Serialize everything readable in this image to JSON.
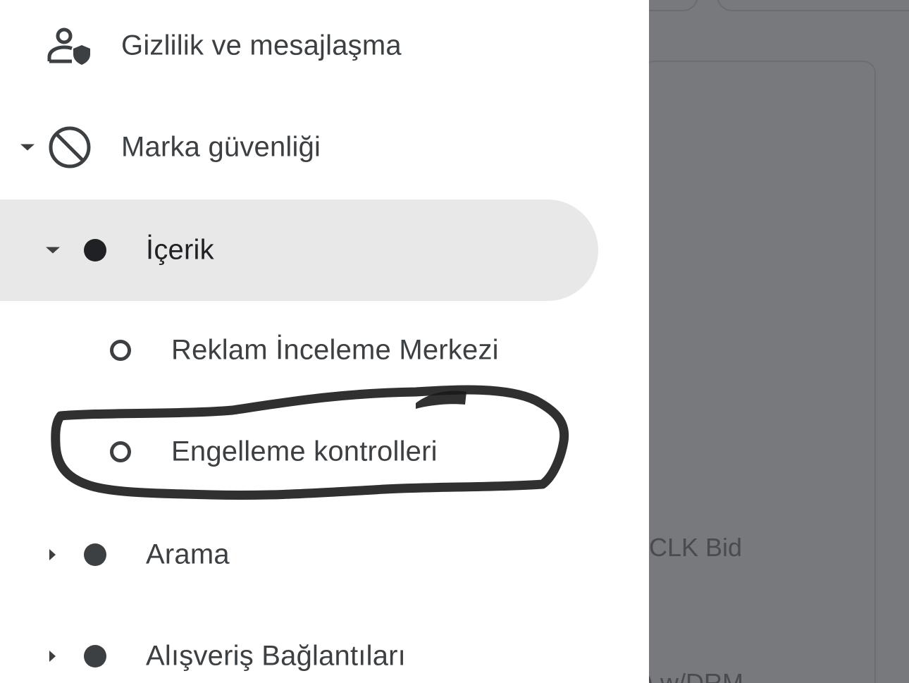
{
  "drawer": {
    "items": [
      {
        "label": "Gizlilik ve mesajlaşma",
        "icon": "person-shield-icon",
        "level": 0,
        "expanded": null
      },
      {
        "label": "Marka güvenliği",
        "icon": "block-icon",
        "level": 0,
        "expanded": true
      },
      {
        "label": "İçerik",
        "icon": "dot-filled-icon",
        "level": 1,
        "expanded": true,
        "selected": true
      },
      {
        "label": "Reklam İnceleme Merkezi",
        "icon": "dot-outline-icon",
        "level": 2
      },
      {
        "label": "Engelleme kontrolleri",
        "icon": "dot-outline-icon",
        "level": 2,
        "annotated": true
      },
      {
        "label": "Arama",
        "icon": "dot-filled-icon",
        "level": 1,
        "expanded": false
      },
      {
        "label": "Alışveriş Bağlantıları",
        "icon": "dot-filled-icon",
        "level": 1,
        "expanded": false
      }
    ]
  },
  "background": {
    "partial_text_1": "CLK Bid",
    "partial_text_2": ") w/DRM"
  },
  "colors": {
    "selected_bg": "#e8e8e8",
    "text": "#3c4043",
    "scrim": "#78797c",
    "annotation_ink": "#1a1a1a"
  }
}
